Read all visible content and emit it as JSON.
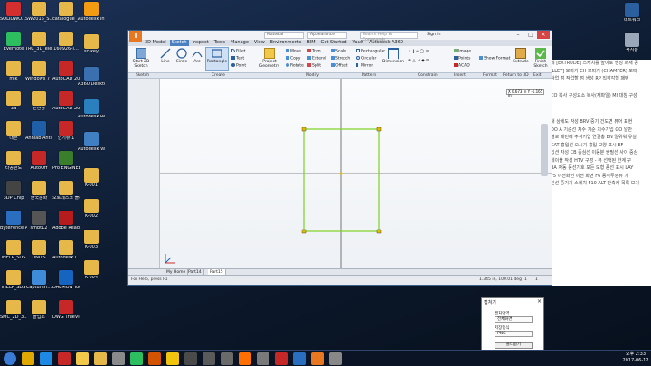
{
  "desktop": {
    "left_icons": [
      {
        "label": "SOLIDWO... 2016 x64 ...",
        "color": "#d32f2f",
        "icon": "solidworks-icon"
      },
      {
        "label": "Evernote",
        "color": "#2dbe60",
        "icon": "evernote-icon"
      },
      {
        "label": "mjk",
        "color": "#e6b84a",
        "icon": "folder-icon"
      },
      {
        "label": "3d",
        "color": "#e6b84a",
        "icon": "folder-icon"
      },
      {
        "label": "대본",
        "color": "#e6b84a",
        "icon": "folder-icon"
      },
      {
        "label": "타공판도",
        "color": "#e6b84a",
        "icon": "folder-icon"
      },
      {
        "label": "3DP Chip",
        "color": "#444",
        "icon": "chip-icon"
      },
      {
        "label": "ByteFence Anti-Malware",
        "color": "#2a6ebf",
        "icon": "bytefence-icon"
      },
      {
        "label": "IHELP_SDS",
        "color": "#e6b84a",
        "icon": "folder-icon"
      },
      {
        "label": "IHELP_SDS",
        "color": "#e6b84a",
        "icon": "folder-icon"
      },
      {
        "label": "SMC_2D_3...",
        "color": "#e6b84a",
        "icon": "folder-icon"
      }
    ],
    "col2_icons": [
      {
        "label": "SW2016_S...",
        "color": "#e6b84a",
        "icon": "folder-icon"
      },
      {
        "label": "TRC_3D_ele...",
        "color": "#e6b84a",
        "icon": "folder-icon"
      },
      {
        "label": "Windows 7 160212 통합",
        "color": "#e6b84a",
        "icon": "folder-icon"
      },
      {
        "label": "친환경",
        "color": "#e6b84a",
        "icon": "folder-icon"
      },
      {
        "label": "Ahnlab Anti-Ranso...",
        "color": "#1e5fa8",
        "icon": "ahnlab-icon"
      },
      {
        "label": "AutoOff",
        "color": "#c62828",
        "icon": "power-icon"
      },
      {
        "label": "한국문화",
        "color": "#e6b84a",
        "icon": "folder-icon"
      },
      {
        "label": "smbt12",
        "color": "#555",
        "icon": "app-icon"
      },
      {
        "label": "UNITS",
        "color": "#e6b84a",
        "icon": "folder-icon"
      },
      {
        "label": "CaptureH...",
        "color": "#3d8bd9",
        "icon": "capture-icon"
      },
      {
        "label": "졸업조",
        "color": "#e6b84a",
        "icon": "folder-icon"
      }
    ],
    "col3_icons": [
      {
        "label": "catalogue_...",
        "color": "#e6b84a",
        "icon": "folder-icon"
      },
      {
        "label": "160926-T...",
        "color": "#e6b84a",
        "icon": "folder-icon"
      },
      {
        "label": "AutoCAD 2016",
        "color": "#c62828",
        "icon": "autocad-icon"
      },
      {
        "label": "AutoCAD 2017 - 한...",
        "color": "#c62828",
        "icon": "autocad-icon"
      },
      {
        "label": "인기뷰 1",
        "color": "#c62828",
        "icon": "app-icon"
      },
      {
        "label": "Pro ENGINEER",
        "color": "#3a7d2a",
        "icon": "proe-icon"
      },
      {
        "label": "오토데스크 플러스",
        "color": "#e6b84a",
        "icon": "folder-icon"
      },
      {
        "label": "Adobe Reader XI",
        "color": "#b71c1c",
        "icon": "acrobat-icon"
      },
      {
        "label": "Autodesk L...",
        "color": "#e6b84a",
        "icon": "folder-icon"
      },
      {
        "label": "DAEMON Tools Lite",
        "color": "#1565c0",
        "icon": "daemon-icon"
      },
      {
        "label": "DWG TrueVie...",
        "color": "#c62828",
        "icon": "dwg-icon"
      }
    ],
    "col4_icons": [
      {
        "label": "Autodesk Invento...",
        "color": "#f39c12",
        "icon": "inventor-icon"
      },
      {
        "label": "sc-key",
        "color": "#e6b84a",
        "icon": "folder-icon"
      },
      {
        "label": "A360 Desktop",
        "color": "#3a6fb0",
        "icon": "a360-icon"
      },
      {
        "label": "Autodesk ReCap 2016",
        "color": "#2a7fbf",
        "icon": "recap-icon"
      },
      {
        "label": "Autodesk Vault Bas...",
        "color": "#3f7fc2",
        "icon": "vault-icon"
      },
      {
        "label": "K-001",
        "color": "#e6b84a",
        "icon": "folder-icon"
      },
      {
        "label": "K-002",
        "color": "#e6b84a",
        "icon": "folder-icon"
      },
      {
        "label": "K-003",
        "color": "#e6b84a",
        "icon": "folder-icon"
      },
      {
        "label": "K-004",
        "color": "#e6b84a",
        "icon": "folder-icon"
      }
    ],
    "right_icons": [
      {
        "label": "네트워크",
        "color": "#2a5fa0",
        "icon": "network-icon"
      },
      {
        "label": "휴지통",
        "color": "#9aa7b8",
        "icon": "recycle-bin-icon"
      }
    ]
  },
  "document": {
    "lines": [
      "레 [EXTRUDE] 스케치를 높이로 생성 파재 공",
      "ILLET] 모따기  CH 모따기 (CHAMFER) 모따",
      "작업 점 작업할 점 생성  RP 직각각형 패턴",
      "CO 복사 구성요소 복사(재파일)  MI 대칭 구성",
      "새 상세도 작성  BRV 중기 건도면 뷰어 표현",
      "DO A 기준선 치수 기준 치수기입  GO 일반",
      "열로 패턴에 주석기입 연결총 BN 일위워 유실",
      "CAT 흉입선 오시기 흉입 모양 표시  EF",
      "있션 자성  CB 중심선 이등분 쌍필선 사이 중심",
      "테이블 작성  HTV 구멍 - 뷰 선택된 한계 구",
      "BA 자동 풍선기호 모든 모형 풍선 표시  LAY",
      "  F5 이전화면 이전 화면  F6 등각투영뷰 기",
      "진선 중기기 스케치 F10 ALT 단축키 목록 보기"
    ]
  },
  "app": {
    "title_combo1": "Material",
    "title_combo2": "Appearance",
    "help_search": "Search Help & Commands...",
    "signin": "Sign In",
    "tabs": [
      "3D Model",
      "Sketch",
      "Inspect",
      "Tools",
      "Manage",
      "View",
      "Environments",
      "BIM",
      "Get Started",
      "Vault",
      "Autodesk A360"
    ],
    "active_tab": "Sketch",
    "ribbon": {
      "start_sketch": "Start 2D Sketch",
      "line": "Line",
      "circle": "Circle",
      "arc": "Arc",
      "rectangle": "Rectangle",
      "fillet": "Fillet",
      "text": "Text",
      "point": "Point",
      "project_geometry": "Project Geometry",
      "move": "Move",
      "copy": "Copy",
      "rotate": "Rotate",
      "trim": "Trim",
      "extend": "Extend",
      "split": "Split",
      "scale": "Scale",
      "stretch": "Stretch",
      "offset": "Offset",
      "rectangular": "Rectangular",
      "circular": "Circular",
      "mirror": "Mirror",
      "dimension": "Dimension",
      "image": "Image",
      "points": "Points",
      "acad": "ACAD",
      "show_format": "Show Format",
      "extrude": "Extrude",
      "finish_sketch": "Finish Sketch"
    },
    "groups": [
      "Sketch",
      "Create",
      "Modify",
      "Pattern",
      "Constrain",
      "Insert",
      "Format",
      "Return to 3D",
      "Exit"
    ],
    "coord_readout": "X 0.673 in  Y -1.165 in",
    "doc_tabs": [
      "My Home",
      "Part14",
      "Part15"
    ],
    "status_left": "For Help, press F1",
    "status_right": "1.345 in, 100.01 deg",
    "status_nums": [
      "1",
      "1"
    ],
    "colors": {
      "accent": "#4a7fc0",
      "sketch_green": "#7ed321",
      "inventor_orange": "#e87722"
    }
  },
  "popup": {
    "title": "캡쳐기",
    "label_area": "캡처영역",
    "area_value": "전체화면",
    "label_format": "저장형식",
    "format_value": "PNG",
    "button_open": "폴더열기",
    "button_close": "닫기",
    "close_icon": "×"
  },
  "taskbar": {
    "icons": [
      "start-icon",
      "chrome-icon",
      "ie-icon",
      "acrobat-icon",
      "explorer-icon",
      "folder-icon",
      "app-icon",
      "line-icon",
      "paint-icon",
      "kakao-icon",
      "app-icon",
      "app-icon",
      "app-icon",
      "illustrator-icon",
      "app-icon",
      "app-icon",
      "app-icon",
      "inventor-icon",
      "app-icon"
    ],
    "time": "오후 2:33",
    "date": "2017-06-12"
  }
}
